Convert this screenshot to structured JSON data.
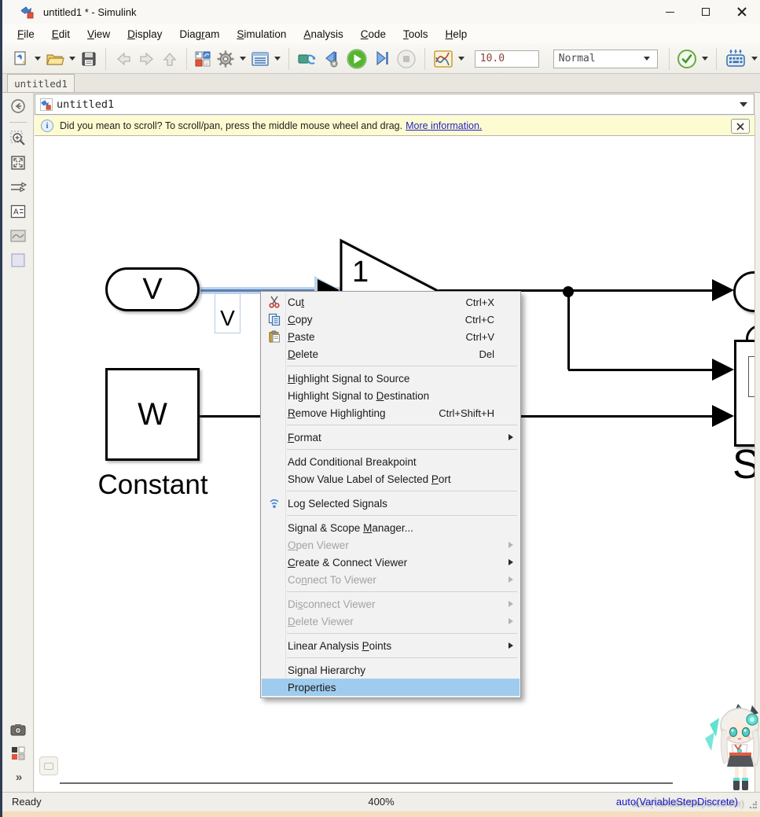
{
  "window": {
    "title": "untitled1 * - Simulink"
  },
  "menu_bar": [
    {
      "label": "File",
      "u": 0
    },
    {
      "label": "Edit",
      "u": 0
    },
    {
      "label": "View",
      "u": 0
    },
    {
      "label": "Display",
      "u": 0
    },
    {
      "label": "Diagram",
      "u": 4
    },
    {
      "label": "Simulation",
      "u": 0
    },
    {
      "label": "Analysis",
      "u": 0
    },
    {
      "label": "Code",
      "u": 0
    },
    {
      "label": "Tools",
      "u": 0
    },
    {
      "label": "Help",
      "u": 0
    }
  ],
  "toolbar": {
    "stop_time": "10.0",
    "mode": "Normal"
  },
  "tab": "untitled1",
  "breadcrumb": "untitled1",
  "notification": {
    "message": "Did you mean to scroll? To scroll/pan, press the middle mouse wheel and drag.",
    "link": "More information."
  },
  "canvas": {
    "inport_label": "V",
    "signal_label": "V",
    "gain_value": "1",
    "constant_value": "W",
    "constant_name": "Constant",
    "scope_partial_label": "S"
  },
  "context_menu": {
    "items": [
      {
        "label": "Cut",
        "u": 2,
        "shortcut": "Ctrl+X",
        "icon": "cut",
        "enabled": true
      },
      {
        "label": "Copy",
        "u": 0,
        "shortcut": "Ctrl+C",
        "icon": "copy",
        "enabled": true
      },
      {
        "label": "Paste",
        "u": 0,
        "shortcut": "Ctrl+V",
        "icon": "paste",
        "enabled": true
      },
      {
        "label": "Delete",
        "u": 0,
        "shortcut": "Del",
        "enabled": true
      },
      {
        "sep": true
      },
      {
        "label": "Highlight Signal to Source",
        "u": 0,
        "enabled": true
      },
      {
        "label": "Highlight Signal to Destination",
        "u": 20,
        "enabled": true
      },
      {
        "label": "Remove Highlighting",
        "u": 0,
        "shortcut": "Ctrl+Shift+H",
        "enabled": true
      },
      {
        "sep": true
      },
      {
        "label": "Format",
        "u": 0,
        "submenu": true,
        "enabled": true
      },
      {
        "sep": true
      },
      {
        "label": "Add Conditional Breakpoint",
        "u": -1,
        "enabled": true
      },
      {
        "label": "Show Value Label of Selected Port",
        "u": 29,
        "enabled": true
      },
      {
        "sep": true
      },
      {
        "label": "Log Selected Signals",
        "u": -1,
        "icon": "wifi",
        "enabled": true
      },
      {
        "sep": true
      },
      {
        "label": "Signal & Scope Manager...",
        "u": 15,
        "enabled": true
      },
      {
        "label": "Open Viewer",
        "u": 0,
        "submenu": true,
        "enabled": false
      },
      {
        "label": "Create & Connect Viewer",
        "u": 0,
        "submenu": true,
        "enabled": true
      },
      {
        "label": "Connect To Viewer",
        "u": 2,
        "submenu": true,
        "enabled": false
      },
      {
        "sep": true
      },
      {
        "label": "Disconnect Viewer",
        "u": 2,
        "submenu": true,
        "enabled": false
      },
      {
        "label": "Delete Viewer",
        "u": 0,
        "submenu": true,
        "enabled": false
      },
      {
        "sep": true
      },
      {
        "label": "Linear Analysis Points",
        "u": 16,
        "submenu": true,
        "enabled": true
      },
      {
        "sep": true
      },
      {
        "label": "Signal Hierarchy",
        "u": -1,
        "enabled": true
      },
      {
        "label": "Properties",
        "u": -1,
        "enabled": true,
        "selected": true
      }
    ]
  },
  "status_bar": {
    "left": "Ready",
    "center": "400%",
    "right": "auto(VariableStepDiscrete)"
  },
  "colors": {
    "selection_highlight": "#9fccee",
    "wire_highlight": "#bdd3ee",
    "notification_bg": "#fdfcd0",
    "link_blue": "#2323cc",
    "status_solver_blue": "#1717c9",
    "run_green": "#4caf2e",
    "titlebar_bg": "#faf8f4"
  }
}
